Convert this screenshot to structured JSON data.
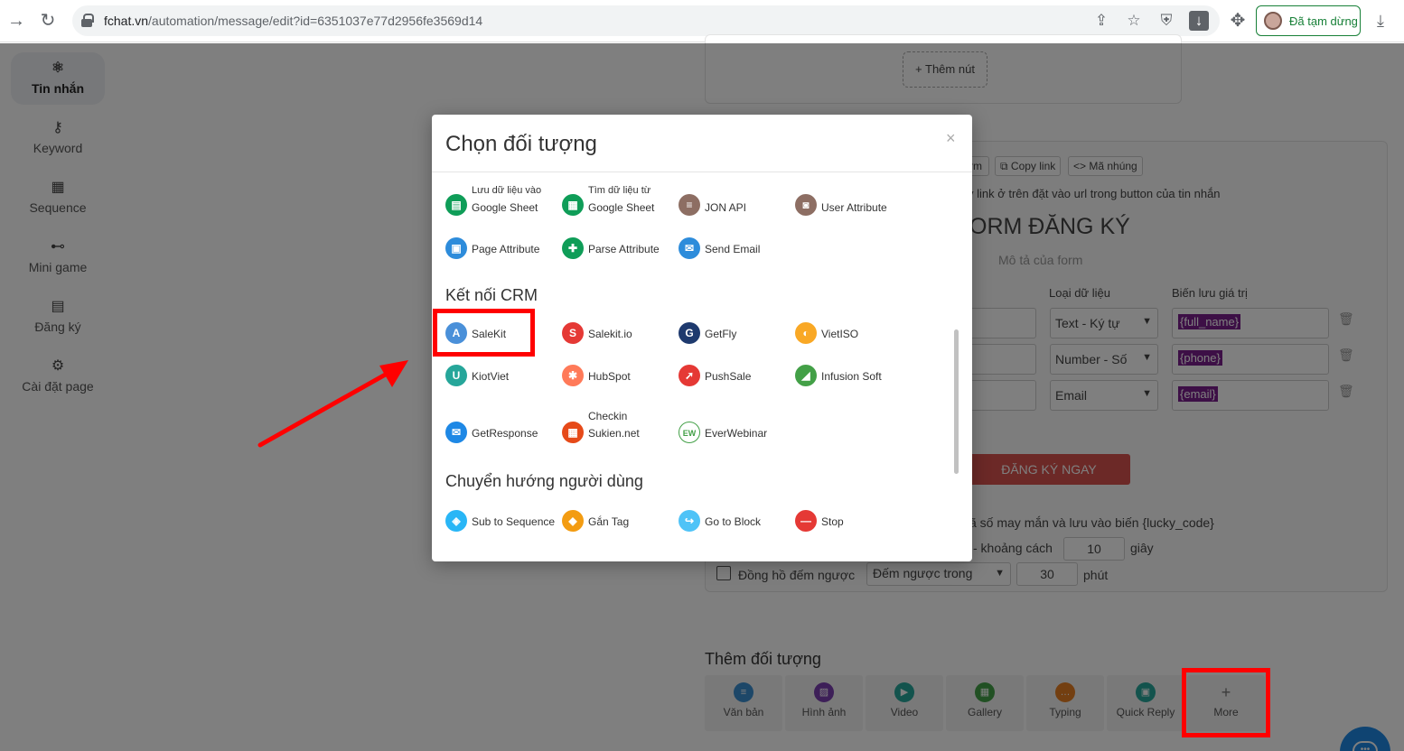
{
  "browser": {
    "url_host": "fchat.vn",
    "url_path": "/automation/message/edit?id=6351037e77d2956fe3569d14",
    "paused_label": "Đã tạm dừng"
  },
  "sidebar": {
    "items": [
      {
        "label": "Tin nhắn",
        "icon": "atom-icon"
      },
      {
        "label": "Keyword",
        "icon": "key-icon"
      },
      {
        "label": "Sequence",
        "icon": "calendar-icon"
      },
      {
        "label": "Mini game",
        "icon": "gamepad-icon"
      },
      {
        "label": "Đăng ký",
        "icon": "form-icon"
      },
      {
        "label": "Cài đặt page",
        "icon": "gear-icon"
      }
    ]
  },
  "background": {
    "add_button": "+ Thêm nút",
    "copy_link": "Copy link",
    "embed": "Mã nhúng",
    "tb_partial": "rm",
    "hint": "y link ở trên đặt vào url trong button của tin nhắn",
    "form_title": "ORM ĐĂNG KÝ",
    "form_desc": "Mô tả của form",
    "col_type": "Loại dữ liệu",
    "col_var": "Biến lưu giá trị",
    "rows": [
      {
        "type": "Text - Ký tự",
        "var": "{full_name}"
      },
      {
        "type": "Number - Số",
        "var": "{phone}"
      },
      {
        "type": "Email",
        "var": "{email}"
      }
    ],
    "submit": "ĐĂNG KÝ NGAY",
    "lucky_line": "ã số may mắn và lưu vào biến {lucky_code}",
    "distance_label": "- khoảng cách",
    "distance_value": "10",
    "distance_unit": "giây",
    "countdown_label": "Đồng hồ đếm ngược",
    "countdown_select": "Đếm ngược trong",
    "countdown_value": "30",
    "countdown_unit": "phút",
    "add_objects_title": "Thêm đối tượng",
    "objects": [
      {
        "label": "Văn bản",
        "color": "#3b8ed0"
      },
      {
        "label": "Hình ảnh",
        "color": "#7b3fb0"
      },
      {
        "label": "Video",
        "color": "#26a69a"
      },
      {
        "label": "Gallery",
        "color": "#43a047"
      },
      {
        "label": "Typing",
        "color": "#e67e22"
      },
      {
        "label": "Quick Reply",
        "color": "#26a69a"
      },
      {
        "label": "More",
        "color": "#999999"
      }
    ]
  },
  "modal": {
    "title": "Chọn đối tượng",
    "close": "×",
    "sections": {
      "crm": "Kết nối CRM",
      "redirect": "Chuyển hướng người dùng"
    },
    "top_items": [
      {
        "l1": "Lưu dữ liệu vào",
        "l2": "Google Sheet",
        "color": "#0f9d58",
        "glyph": "▤"
      },
      {
        "l1": "Tìm dữ liệu từ",
        "l2": "Google Sheet",
        "color": "#0f9d58",
        "glyph": "▦"
      },
      {
        "l1": "",
        "l2": "JON API",
        "color": "#8d6e63",
        "glyph": "≡"
      },
      {
        "l1": "",
        "l2": "User Attribute",
        "color": "#8d6e63",
        "glyph": "◙"
      },
      {
        "l1": "",
        "l2": "Page Attribute",
        "color": "#2d8cdb",
        "glyph": "▣"
      },
      {
        "l1": "",
        "l2": "Parse Attribute",
        "color": "#0f9d58",
        "glyph": "✚"
      },
      {
        "l1": "",
        "l2": "Send Email",
        "color": "#2d8cdb",
        "glyph": "✉"
      }
    ],
    "crm_items": [
      {
        "l1": "",
        "l2": "SaleKit",
        "color": "#4a90d9",
        "glyph": "A"
      },
      {
        "l1": "",
        "l2": "Salekit.io",
        "color": "#e53935",
        "glyph": "S"
      },
      {
        "l1": "",
        "l2": "GetFly",
        "color": "#1e3a6e",
        "glyph": "G"
      },
      {
        "l1": "",
        "l2": "VietISO",
        "color": "#f9a825",
        "glyph": "◐"
      },
      {
        "l1": "",
        "l2": "KiotViet",
        "color": "#26a69a",
        "glyph": "U"
      },
      {
        "l1": "",
        "l2": "HubSpot",
        "color": "#ff7a59",
        "glyph": "✱"
      },
      {
        "l1": "",
        "l2": "PushSale",
        "color": "#e53935",
        "glyph": "➚"
      },
      {
        "l1": "",
        "l2": "Infusion Soft",
        "color": "#43a047",
        "glyph": "◢"
      },
      {
        "l1": "",
        "l2": "GetResponse",
        "color": "#1e88e5",
        "glyph": "✉"
      },
      {
        "l1": "Checkin",
        "l2": "Sukien.net",
        "color": "#e64a19",
        "glyph": "▦"
      },
      {
        "l1": "",
        "l2": "EverWebinar",
        "color": "#43a047",
        "glyph": "EW"
      }
    ],
    "redirect_items": [
      {
        "l1": "",
        "l2": "Sub to Sequence",
        "color": "#29b6f6",
        "glyph": "◈"
      },
      {
        "l1": "",
        "l2": "Gắn Tag",
        "color": "#f39c12",
        "glyph": "◆"
      },
      {
        "l1": "",
        "l2": "Go to Block",
        "color": "#4fc3f7",
        "glyph": "↪"
      },
      {
        "l1": "",
        "l2": "Stop",
        "color": "#e53935",
        "glyph": "—"
      }
    ]
  },
  "colors": {
    "annotation_red": "#ff0000",
    "submit_red": "#d9534f",
    "chat_blue": "#1e88e5"
  }
}
